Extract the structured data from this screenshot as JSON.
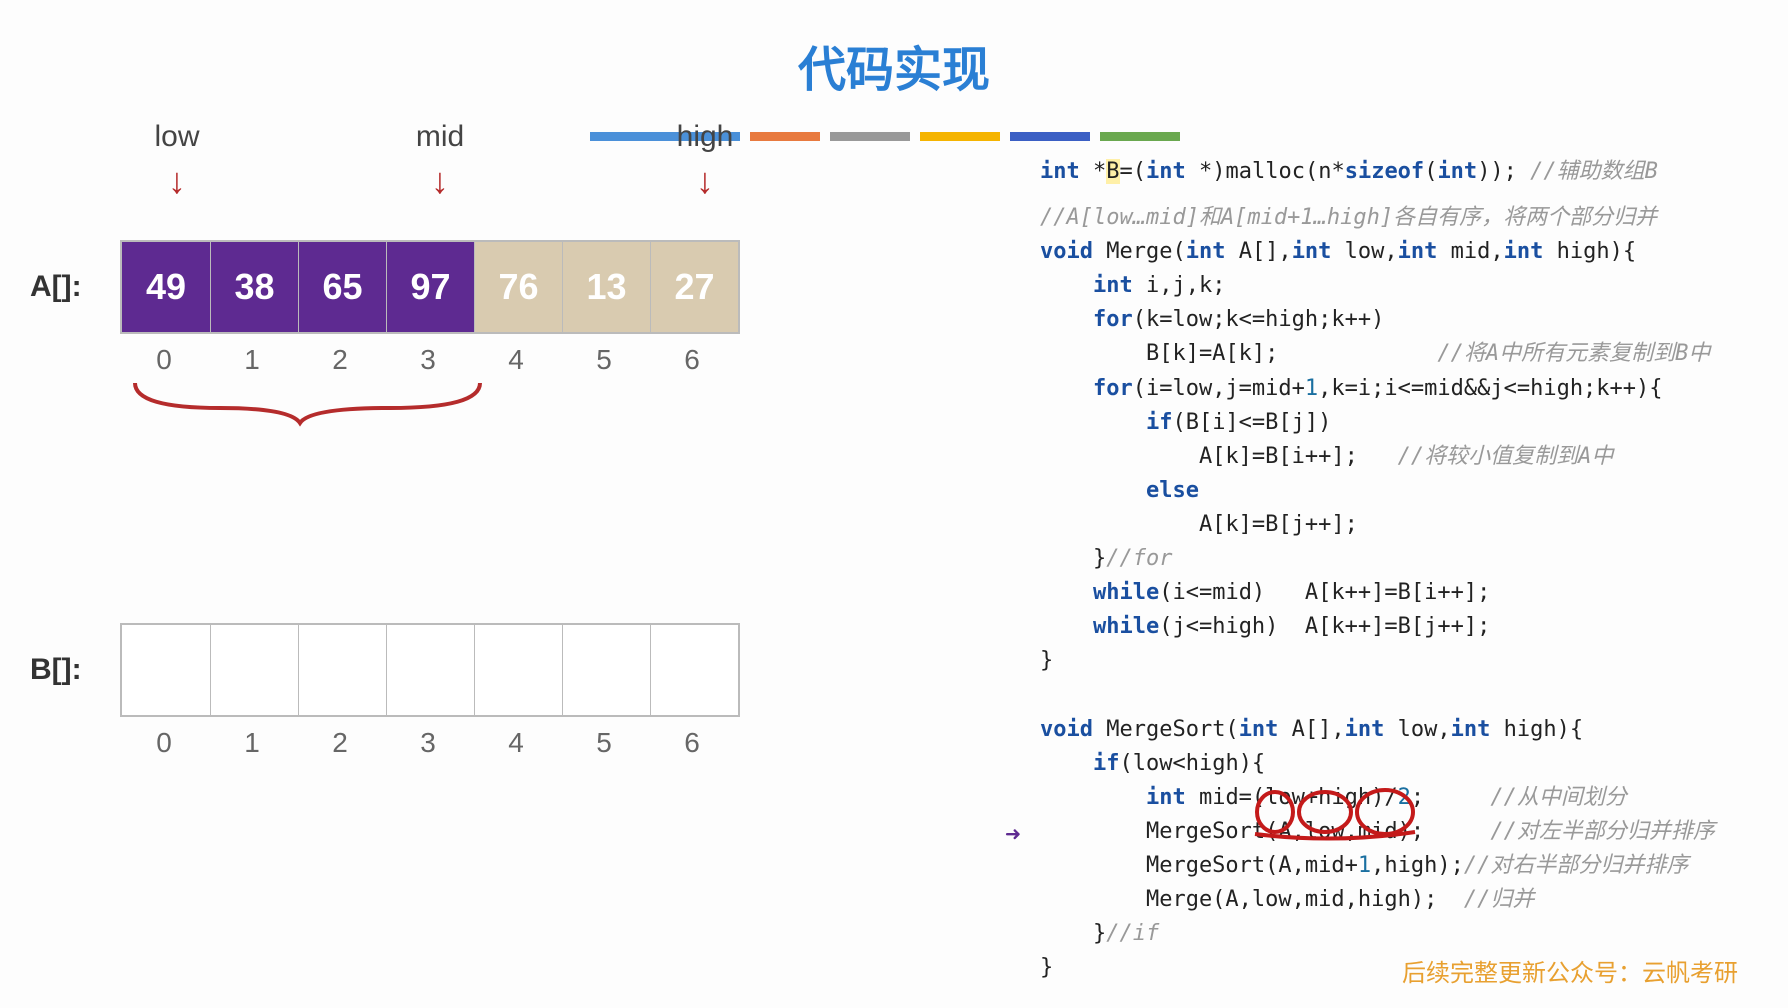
{
  "title": "代码实现",
  "pointers": {
    "low": "low",
    "mid": "mid",
    "high": "high"
  },
  "arrayA": {
    "label": "A[]:",
    "cells": [
      {
        "v": "49",
        "style": "purple"
      },
      {
        "v": "38",
        "style": "purple"
      },
      {
        "v": "65",
        "style": "purple"
      },
      {
        "v": "97",
        "style": "purple"
      },
      {
        "v": "76",
        "style": "tan"
      },
      {
        "v": "13",
        "style": "tan"
      },
      {
        "v": "27",
        "style": "tan"
      }
    ],
    "indices": [
      "0",
      "1",
      "2",
      "3",
      "4",
      "5",
      "6"
    ]
  },
  "arrayB": {
    "label": "B[]:",
    "cells": [
      {
        "v": "",
        "style": "empty"
      },
      {
        "v": "",
        "style": "empty"
      },
      {
        "v": "",
        "style": "empty"
      },
      {
        "v": "",
        "style": "empty"
      },
      {
        "v": "",
        "style": "empty"
      },
      {
        "v": "",
        "style": "empty"
      },
      {
        "v": "",
        "style": "empty"
      }
    ],
    "indices": [
      "0",
      "1",
      "2",
      "3",
      "4",
      "5",
      "6"
    ]
  },
  "code": {
    "l1a": "int",
    "l1b": " *",
    "l1c": "B",
    "l1d": "=(",
    "l1e": "int",
    "l1f": " *)malloc(n*",
    "l1g": "sizeof",
    "l1h": "(",
    "l1i": "int",
    "l1j": ")); ",
    "l1k": "//辅助数组B",
    "l2": "//A[low…mid]和A[mid+1…high]各自有序，将两个部分归并",
    "l3a": "void",
    "l3b": " Merge(",
    "l3c": "int",
    "l3d": " A[],",
    "l3e": "int",
    "l3f": " low,",
    "l3g": "int",
    "l3h": " mid,",
    "l3i": "int",
    "l3j": " high){",
    "l4a": "    int",
    "l4b": " i,j,k;",
    "l5a": "    for",
    "l5b": "(k=low;k<=high;k++)",
    "l6a": "        B[k]=A[k];",
    "l6b": "            //将A中所有元素复制到B中",
    "l7a": "    for",
    "l7b": "(i=low,j=mid+",
    "l7c": "1",
    "l7d": ",k=i;i<=mid&&j<=high;k++){",
    "l8a": "        if",
    "l8b": "(B[i]<=B[j])",
    "l9a": "            A[k]=B[i++];",
    "l9b": "   //将较小值复制到A中",
    "l10a": "        else",
    "l11": "            A[k]=B[j++];",
    "l12": "    }",
    "l12b": "//for",
    "l13a": "    while",
    "l13b": "(i<=mid)   A[k++]=B[i++];",
    "l14a": "    while",
    "l14b": "(j<=high)  A[k++]=B[j++];",
    "l15": "}",
    "blank": "",
    "l16a": "void",
    "l16b": " MergeSort(",
    "l16c": "int",
    "l16d": " A[],",
    "l16e": "int",
    "l16f": " low,",
    "l16g": "int",
    "l16h": " high){",
    "l17a": "    if",
    "l17b": "(low<high){",
    "l18a": "        int",
    "l18b": " mid=(low+high)/",
    "l18c": "2",
    "l18d": ";",
    "l18e": "     //从中间划分",
    "l19a": "        MergeSort(A,low,mid);",
    "l19b": "     //对左半部分归并排序",
    "l20a": "        MergeSort(A,mid+",
    "l20b": "1",
    "l20c": ",high);",
    "l20d": "//对右半部分归并排序",
    "l21a": "        Merge(A,low,mid,high);",
    "l21b": "  //归并",
    "l22": "    }",
    "l22b": "//if",
    "l23": "}"
  },
  "watermark": "后续完整更新公众号：云帆考研"
}
